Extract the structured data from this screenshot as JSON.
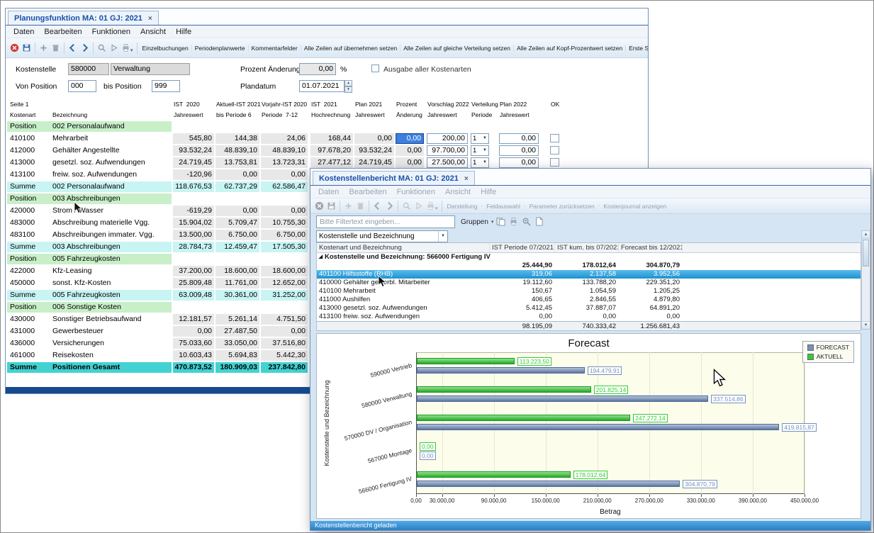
{
  "window1": {
    "tab": "Planungsfunktion MA: 01 GJ: 2021",
    "close": "×",
    "statusbar": "",
    "menu": [
      "Daten",
      "Bearbeiten",
      "Funktionen",
      "Ansicht",
      "Hilfe"
    ],
    "toolbar": {
      "icons": [
        "cancel",
        "save",
        "add",
        "delete",
        "back",
        "forward",
        "search",
        "play",
        "print"
      ],
      "buttons": [
        "Einzelbuchungen",
        "Periodenplanwerte",
        "Kommentarfelder",
        "Alle Zeilen auf übernehmen setzen",
        "Alle Zeilen auf gleiche Verteilung setzen",
        "Alle Zeilen auf Kopf-Prozentwert setzen",
        "Erste Seite"
      ],
      "overflow": "»"
    },
    "form": {
      "kostenstelle_label": "Kostenstelle",
      "kostenstelle_nr": "580000",
      "kostenstelle_name": "Verwaltung",
      "von_label": "Von Position",
      "von_value": "000",
      "bis_label": "bis Position",
      "bis_value": "999",
      "prozent_label": "Prozent Änderung",
      "prozent_value": "0,00",
      "prozent_unit": "%",
      "plandatum_label": "Plandatum",
      "plandatum_value": "01.07.2021",
      "ausgabe_checkbox_label": "Ausgabe aller Kostenarten"
    },
    "table": {
      "header_top": {
        "kostenart": "Seite 1",
        "ist2020": "IST  2020",
        "aktuell": "Aktuell-IST 2021",
        "vorjahr": "Vorjahr-IST 2020",
        "ist2021": "IST  2021",
        "plan2021": "Plan 2021",
        "prozent": "Prozent",
        "vorschlag": "Vorschlag 2022",
        "verteilung": "Verteilung",
        "plan2022": "Plan 2022",
        "ok": "OK"
      },
      "header_sub": {
        "kostenart": "Kostenart",
        "bezeichnung": "Bezeichnung",
        "ist2020": "Jahreswert",
        "aktuell": "bis Periode 6",
        "vorjahr": "Periode  7-12",
        "ist2021": "Hochrechnung",
        "plan2021": "Jahreswert",
        "prozent": "Änderung",
        "vorschlag": "Jahreswert",
        "verteilung": "Periode",
        "plan2022": "Jahreswert"
      },
      "rows": [
        {
          "type": "position",
          "kostenart": "Position",
          "bezeichnung": "002 Personalaufwand"
        },
        {
          "type": "data",
          "kostenart": "410100",
          "bezeichnung": "Mehrarbeit",
          "ist2020": "545,80",
          "aktuell": "144,38",
          "vorjahr": "24,06",
          "ist2021": "168,44",
          "plan2021": "0,00",
          "prozent": "0,00",
          "prozent_selected": true,
          "vorschlag": "200,00",
          "verteilung": "1",
          "plan2022": "0,00",
          "ok_checkbox": true
        },
        {
          "type": "data",
          "kostenart": "412000",
          "bezeichnung": "Gehälter Angestellte",
          "ist2020": "93.532,24",
          "aktuell": "48.839,10",
          "vorjahr": "48.839,10",
          "ist2021": "97.678,20",
          "plan2021": "93.532,24",
          "prozent": "0,00",
          "vorschlag": "97.700,00",
          "verteilung": "1",
          "plan2022": "0,00",
          "ok_checkbox": true
        },
        {
          "type": "data",
          "kostenart": "413000",
          "bezeichnung": "gesetzl. soz. Aufwendungen",
          "ist2020": "24.719,45",
          "aktuell": "13.753,81",
          "vorjahr": "13.723,31",
          "ist2021": "27.477,12",
          "plan2021": "24.719,45",
          "prozent": "0,00",
          "vorschlag": "27.500,00",
          "verteilung": "1",
          "plan2022": "0,00",
          "ok_checkbox": true
        },
        {
          "type": "data",
          "kostenart": "413100",
          "bezeichnung": "freiw. soz. Aufwendungen",
          "ist2020": "-120,96",
          "aktuell": "0,00",
          "vorjahr": "0,00"
        },
        {
          "type": "sum",
          "kostenart": "Summe",
          "bezeichnung": "002 Personalaufwand",
          "ist2020": "118.676,53",
          "aktuell": "62.737,29",
          "vorjahr": "62.586,47"
        },
        {
          "type": "position",
          "kostenart": "Position",
          "bezeichnung": "003 Abschreibungen"
        },
        {
          "type": "data",
          "kostenart": "420000",
          "bezeichnung": "Strom / Wasser",
          "ist2020": "-619,29",
          "aktuell": "0,00",
          "vorjahr": "0,00"
        },
        {
          "type": "data",
          "kostenart": "483000",
          "bezeichnung": "Abschreibung materielle Vgg.",
          "ist2020": "15.904,02",
          "aktuell": "5.709,47",
          "vorjahr": "10.755,30"
        },
        {
          "type": "data",
          "kostenart": "483100",
          "bezeichnung": "Abschreibungen immater. Vgg.",
          "ist2020": "13.500,00",
          "aktuell": "6.750,00",
          "vorjahr": "6.750,00"
        },
        {
          "type": "sum",
          "kostenart": "Summe",
          "bezeichnung": "003 Abschreibungen",
          "ist2020": "28.784,73",
          "aktuell": "12.459,47",
          "vorjahr": "17.505,30"
        },
        {
          "type": "position",
          "kostenart": "Position",
          "bezeichnung": "005 Fahrzeugkosten"
        },
        {
          "type": "data",
          "kostenart": "422000",
          "bezeichnung": "Kfz-Leasing",
          "ist2020": "37.200,00",
          "aktuell": "18.600,00",
          "vorjahr": "18.600,00"
        },
        {
          "type": "data",
          "kostenart": "450000",
          "bezeichnung": "sonst. Kfz-Kosten",
          "ist2020": "25.809,48",
          "aktuell": "11.761,00",
          "vorjahr": "12.652,00"
        },
        {
          "type": "sum",
          "kostenart": "Summe",
          "bezeichnung": "005 Fahrzeugkosten",
          "ist2020": "63.009,48",
          "aktuell": "30.361,00",
          "vorjahr": "31.252,00"
        },
        {
          "type": "position",
          "kostenart": "Position",
          "bezeichnung": "006 Sonstige Kosten"
        },
        {
          "type": "data",
          "kostenart": "430000",
          "bezeichnung": "Sonstiger Betriebsaufwand",
          "ist2020": "12.181,57",
          "aktuell": "5.261,14",
          "vorjahr": "4.751,50"
        },
        {
          "type": "data",
          "kostenart": "431000",
          "bezeichnung": "Gewerbesteuer",
          "ist2020": "0,00",
          "aktuell": "27.487,50",
          "vorjahr": "0,00"
        },
        {
          "type": "data",
          "kostenart": "436000",
          "bezeichnung": "Versicherungen",
          "ist2020": "75.033,60",
          "aktuell": "33.050,00",
          "vorjahr": "37.516,80"
        },
        {
          "type": "data",
          "kostenart": "461000",
          "bezeichnung": "Reisekosten",
          "ist2020": "10.603,43",
          "aktuell": "5.694,83",
          "vorjahr": "5.442,30"
        },
        {
          "type": "total",
          "kostenart": "Summe",
          "bezeichnung": "Positionen Gesamt",
          "ist2020": "470.873,52",
          "aktuell": "180.909,03",
          "vorjahr": "237.842,80"
        }
      ]
    }
  },
  "window2": {
    "tab": "Kostenstellenbericht MA: 01 GJ: 2021",
    "close": "×",
    "menu": [
      "Daten",
      "Bearbeiten",
      "Funktionen",
      "Ansicht",
      "Hilfe"
    ],
    "toolbar": {
      "icons": [
        "cancel",
        "save",
        "add",
        "delete",
        "back",
        "forward",
        "search",
        "play",
        "print"
      ],
      "buttons": [
        "Darstellung",
        "Feldauswahl",
        "Parameter zurücksetzen",
        "Kostenjournal anzeigen"
      ]
    },
    "filter": {
      "placeholder": "Bitte Filtertext eingeben...",
      "gruppen_label": "Gruppen",
      "icons": [
        "cards",
        "print",
        "zoom",
        "document"
      ]
    },
    "grouping_combo": "Kostenstelle und Bezeichnung",
    "report": {
      "columns": [
        "Kostenart und Bezeichnung",
        "IST Periode 07/2021",
        "IST kum. bis 07/2021",
        "Forecast bis 12/2021"
      ],
      "group_header": "Kostenstelle und Bezeichnung: 566000 Fertigung IV",
      "group_totals": [
        "25.444,90",
        "178.012,64",
        "304.870,79"
      ],
      "rows": [
        {
          "name": "401100 Hilfsstoffe (RHB)",
          "v1": "319,06",
          "v2": "2.137,58",
          "v3": "3.952,56",
          "selected": true
        },
        {
          "name": "410000 Gehälter gewerbl. Mitarbeiter",
          "v1": "19.112,60",
          "v2": "133.788,20",
          "v3": "229.351,20"
        },
        {
          "name": "410100 Mehrarbeit",
          "v1": "150,67",
          "v2": "1.054,59",
          "v3": "1.205,25"
        },
        {
          "name": "411000 Aushilfen",
          "v1": "406,65",
          "v2": "2.846,55",
          "v3": "4.879,80"
        },
        {
          "name": "413000 gesetzl. soz. Aufwendungen",
          "v1": "5.412,45",
          "v2": "37.887,07",
          "v3": "64.891,20"
        },
        {
          "name": "413100 freiw. soz. Aufwendungen",
          "v1": "0,00",
          "v2": "0,00",
          "v3": "0,00"
        }
      ],
      "footer": [
        "98.195,09",
        "740.333,42",
        "1.256.681,43"
      ]
    },
    "statusbar": "Kostenstellenbericht geladen"
  },
  "chart_data": {
    "type": "bar",
    "orientation": "horizontal",
    "title": "Forecast",
    "xlabel": "Betrag",
    "ylabel": "Kostenstelle und Bezeichnung",
    "categories": [
      "590000 Vertrieb",
      "580000 Verwaltung",
      "570000 DV / Organisation",
      "567000 Montage",
      "566000 Fertigung IV"
    ],
    "series": [
      {
        "name": "FORECAST",
        "color": "#7490be",
        "values": [
          194479.91,
          337514.86,
          419815.87,
          0,
          304870.79
        ],
        "labels": [
          "194.479,91",
          "337.514,86",
          "419.815,87",
          "0,00",
          "304.870,79"
        ]
      },
      {
        "name": "AKTUELL",
        "color": "#33cc33",
        "values": [
          113223.5,
          201825.14,
          247272.14,
          0,
          178012.64
        ],
        "labels": [
          "113.223,50",
          "201.825,14",
          "247.272,14",
          "0,00",
          "178.012,64"
        ]
      }
    ],
    "xlim": [
      0,
      450000
    ],
    "xticks": [
      0,
      30000,
      90000,
      150000,
      210000,
      270000,
      330000,
      390000,
      450000
    ],
    "xtick_labels": [
      "0,00",
      "30.000,00",
      "90.000,00",
      "150.000,00",
      "210.000,00",
      "270.000,00",
      "330.000,00",
      "390.000,00",
      "450.000,00"
    ],
    "legend_position": "top-right",
    "grid": true,
    "plot_background": "#fdfdec"
  }
}
